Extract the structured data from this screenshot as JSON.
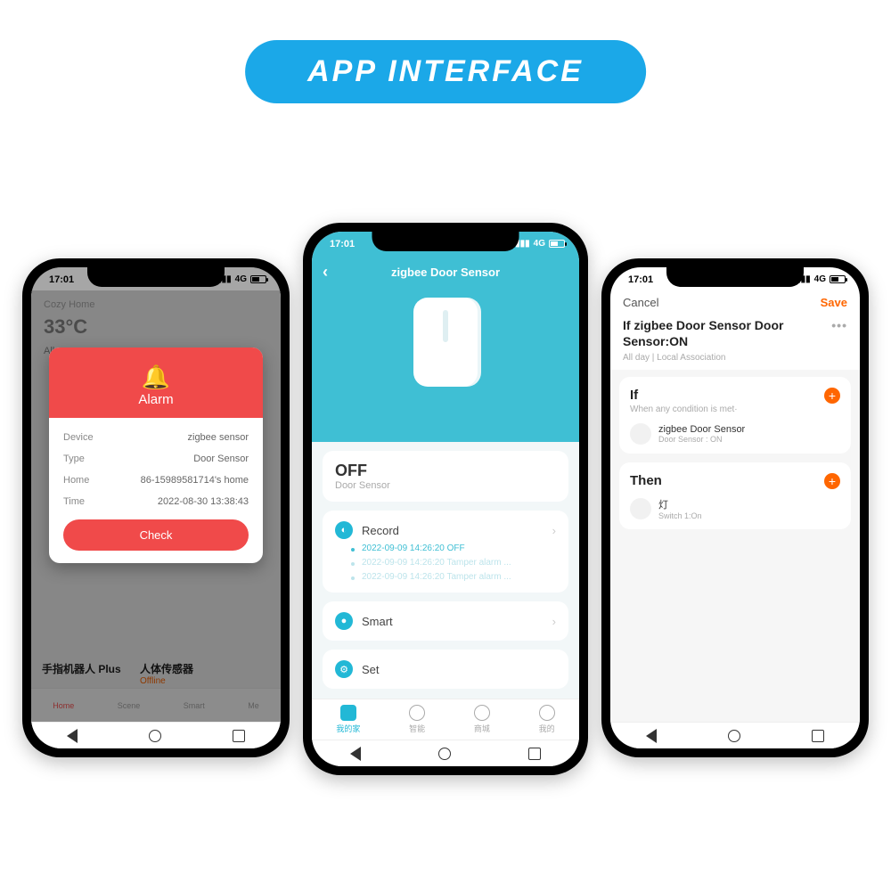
{
  "banner": "APP INTERFACE",
  "status": {
    "time": "17:01",
    "net": "4G"
  },
  "phone1": {
    "home_title": "Cozy Home",
    "temp": "33°C",
    "tab_all": "All",
    "dev1": "手指机器人 Plus",
    "dev2": "人体传感器",
    "dev2_status": "Offline",
    "tabbar": {
      "home": "Home",
      "scene": "Scene",
      "smart": "Smart",
      "me": "Me"
    },
    "modal": {
      "title": "Alarm",
      "rows": {
        "device_k": "Device",
        "device_v": "zigbee sensor",
        "type_k": "Type",
        "type_v": "Door Sensor",
        "home_k": "Home",
        "home_v": "86-15989581714's home",
        "time_k": "Time",
        "time_v": "2022-08-30 13:38:43"
      },
      "button": "Check"
    }
  },
  "phone2": {
    "title": "zigbee Door Sensor",
    "state": "OFF",
    "state_sub": "Door Sensor",
    "record_label": "Record",
    "records": [
      "2022-09-09 14:26:20 OFF",
      "2022-09-09 14:26:20 Tamper alarm ...",
      "2022-09-09 14:26:20 Tamper alarm ..."
    ],
    "smart_label": "Smart",
    "set_label": "Set",
    "tabs": {
      "home": "我的家",
      "smart": "智能",
      "mall": "商城",
      "me": "我的"
    }
  },
  "phone3": {
    "cancel": "Cancel",
    "save": "Save",
    "title": "If zigbee Door Sensor Door Sensor:ON",
    "subtitle": "All day | Local Association",
    "if_label": "If",
    "if_sub": "When any condition is met·",
    "if_item_title": "zigbee Door Sensor",
    "if_item_sub": "Door Sensor : ON",
    "then_label": "Then",
    "then_item_title": "灯",
    "then_item_sub": "Switch 1:On"
  }
}
